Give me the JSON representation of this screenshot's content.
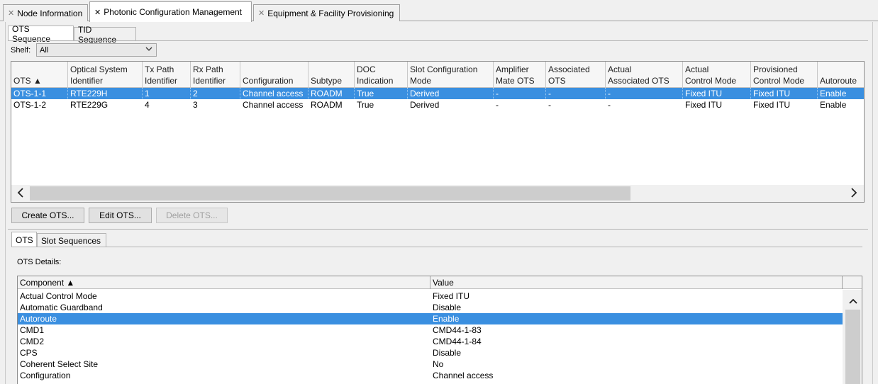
{
  "top_tabs": [
    {
      "label": "Node Information",
      "active": false
    },
    {
      "label": "Photonic Configuration Management",
      "active": true
    },
    {
      "label": "Equipment & Facility Provisioning",
      "active": false
    }
  ],
  "sequence_tabs": [
    {
      "label": "OTS Sequence",
      "active": true
    },
    {
      "label": "TID Sequence",
      "active": false
    }
  ],
  "shelf": {
    "label": "Shelf:",
    "value": "All"
  },
  "ots_table": {
    "columns": [
      "OTS ▲",
      "Optical System Identifier",
      "Tx Path Identifier",
      "Rx Path Identifier",
      "Configuration",
      "Subtype",
      "DOC Indication",
      "Slot Configuration Mode",
      "Amplifier Mate OTS",
      "Associated OTS",
      "Actual Associated OTS",
      "Actual Control Mode",
      "Provisioned Control Mode",
      "Autoroute"
    ],
    "header_lines": [
      [
        "",
        "OTS ▲"
      ],
      [
        "Optical System",
        "Identifier"
      ],
      [
        "Tx Path",
        "Identifier"
      ],
      [
        "Rx Path",
        "Identifier"
      ],
      [
        "",
        "Configuration"
      ],
      [
        "",
        "Subtype"
      ],
      [
        "DOC",
        "Indication"
      ],
      [
        "Slot Configuration",
        "Mode"
      ],
      [
        "Amplifier",
        "Mate OTS"
      ],
      [
        "Associated",
        "OTS"
      ],
      [
        "Actual",
        "Associated OTS"
      ],
      [
        "Actual",
        "Control Mode"
      ],
      [
        "Provisioned",
        "Control Mode"
      ],
      [
        "",
        "Autoroute"
      ]
    ],
    "rows": [
      [
        "OTS-1-1",
        "RTE229H",
        "1",
        "2",
        "Channel access",
        "ROADM",
        "True",
        "Derived",
        "-",
        "-",
        "-",
        "Fixed ITU",
        "Fixed ITU",
        "Enable"
      ],
      [
        "OTS-1-2",
        "RTE229G",
        "4",
        "3",
        "Channel access",
        "ROADM",
        "True",
        "Derived",
        "-",
        "-",
        "-",
        "Fixed ITU",
        "Fixed ITU",
        "Enable"
      ]
    ],
    "selected_row": 0
  },
  "buttons": {
    "create": "Create OTS...",
    "edit": "Edit OTS...",
    "delete": "Delete OTS..."
  },
  "detail_tabs": [
    {
      "label": "OTS",
      "active": true
    },
    {
      "label": "Slot Sequences",
      "active": false
    }
  ],
  "details": {
    "label": "OTS Details:",
    "columns": [
      "Component ▲",
      "Value"
    ],
    "rows": [
      [
        "Actual Control Mode",
        "Fixed ITU"
      ],
      [
        "Automatic Guardband",
        "Disable"
      ],
      [
        "Autoroute",
        "Enable"
      ],
      [
        "CMD1",
        "CMD44-1-83"
      ],
      [
        "CMD2",
        "CMD44-1-84"
      ],
      [
        "CPS",
        "Disable"
      ],
      [
        "Coherent Select Site",
        "No"
      ],
      [
        "Configuration",
        "Channel access"
      ]
    ],
    "selected_row": 2
  },
  "icons": {
    "tab_close": "close-icon",
    "dropdown": "chevron-down-icon",
    "scroll_left": "chevron-left-icon",
    "scroll_right": "chevron-right-icon",
    "scroll_up": "chevron-up-icon"
  },
  "colors": {
    "selection": "#3a8fe0"
  }
}
